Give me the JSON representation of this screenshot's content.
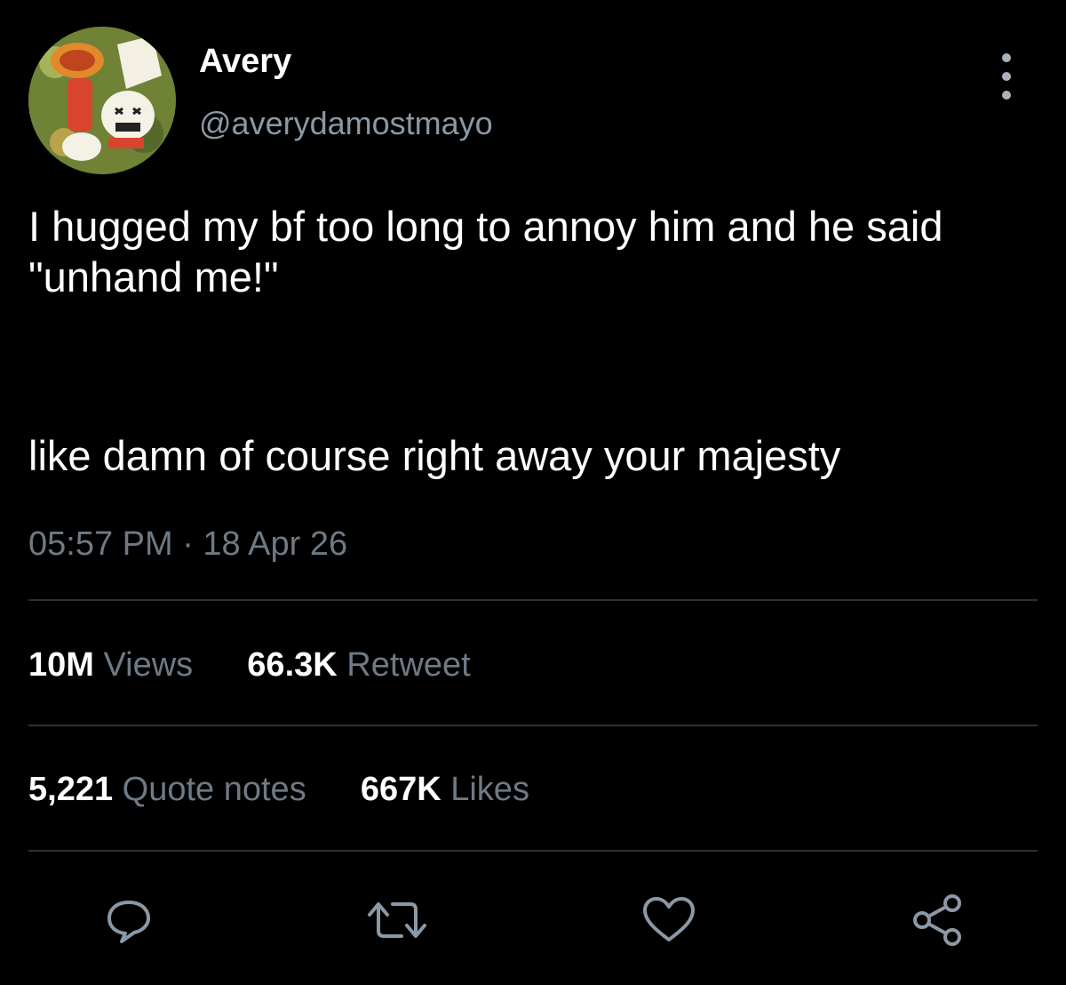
{
  "author": {
    "display_name": "Avery",
    "handle": "@averydamostmayo"
  },
  "tweet": {
    "text_line_1": "I hugged my bf too long to annoy him and he said \"unhand me!\"",
    "text_line_2": "like damn of course right away your majesty",
    "timestamp": "05:57 PM · 18 Apr 26"
  },
  "stats": {
    "views_count": "10M",
    "views_label": "Views",
    "retweets_count": "66.3K",
    "retweets_label": "Retweet",
    "quotes_count": "5,221",
    "quotes_label": "Quote notes",
    "likes_count": "667K",
    "likes_label": "Likes"
  },
  "actions": [
    {
      "icon": "reply-icon"
    },
    {
      "icon": "retweet-icon"
    },
    {
      "icon": "like-icon"
    },
    {
      "icon": "share-icon"
    }
  ],
  "colors": {
    "background": "#000000",
    "text_primary": "#ffffff",
    "text_secondary": "#6e7a85",
    "divider": "#2b3036",
    "icon": "#8b98a5"
  }
}
